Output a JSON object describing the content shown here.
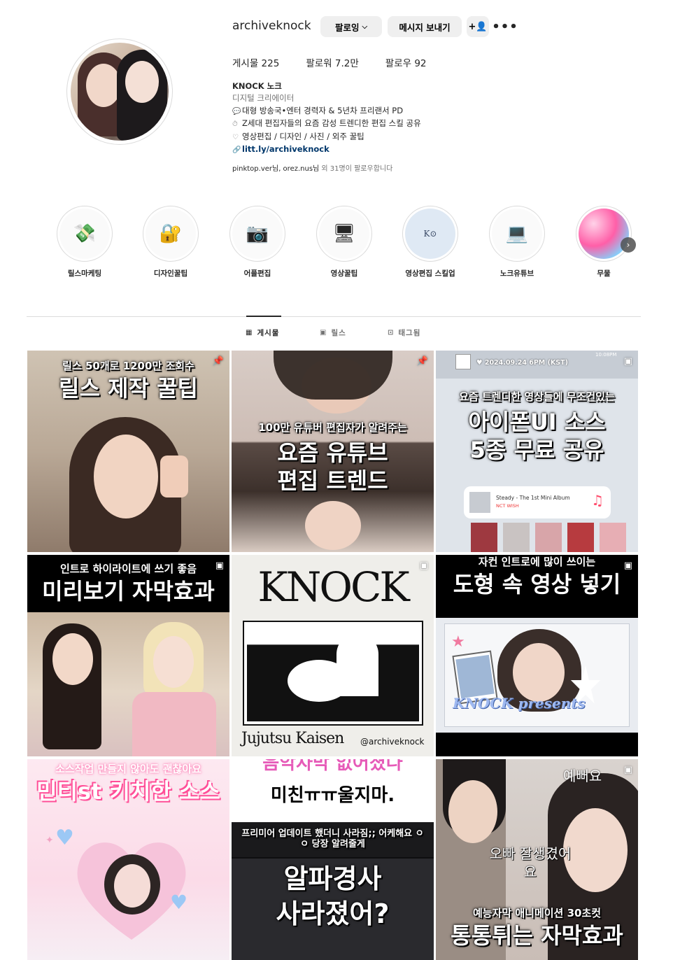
{
  "profile": {
    "username": "archiveknock",
    "follow_button": "팔로잉",
    "message_button": "메시지 보내기",
    "posts_label": "게시물 225",
    "followers_label": "팔로워 7.2만",
    "following_label": "팔로우 92",
    "name": "KNOCK 노크",
    "category": "디지털 크리에이터",
    "bio_lines": [
      "대형 방송국•엔터 경력자 & 5년차 프리랜서 PD",
      "Z세대 편집자들의 요즘 감성 트렌디한 편집 스킬 공유",
      "영상편집 / 디자인 / 사진 / 외주 꿀팁"
    ],
    "link": "litt.ly/archiveknock",
    "followed_by_users": "pinktop.ver님, orez.nus님",
    "followed_by_rest": " 외 31명이 팔로우합니다"
  },
  "highlights": [
    {
      "label": "릴스마케팅",
      "icon": "money-icon"
    },
    {
      "label": "디자인꿀팁",
      "icon": "lock-icon"
    },
    {
      "label": "어플편집",
      "icon": "camera-icon"
    },
    {
      "label": "영상꿀팁",
      "icon": "monitor-icon"
    },
    {
      "label": "영상편집 스킬업",
      "icon": "knock-logo-icon"
    },
    {
      "label": "노크유튜브",
      "icon": "laptop-icon"
    },
    {
      "label": "무물",
      "icon": "gradient-icon"
    }
  ],
  "tabs": [
    {
      "label": "게시물",
      "icon": "grid-icon"
    },
    {
      "label": "릴스",
      "icon": "reels-icon"
    },
    {
      "label": "태그됨",
      "icon": "tag-icon"
    }
  ],
  "posts": [
    {
      "line1": "릴스 50개로 1200만 조회수",
      "line2": "릴스 제작 꿀팁"
    },
    {
      "line1": "100만 유튜버 편집자가 알려주는",
      "line2": "요즘 유튜브",
      "line3": "편집 트렌드"
    },
    {
      "line1": "요즘 트렌디한 영상들에 무조건있는",
      "line2": "아이폰UI 소스",
      "line3": "5종 무료 공유",
      "date": "2024.09.24 6PM (KST)",
      "time": "10:08PM",
      "song": "Steady - The 1st Mini Album",
      "artist": "NCT WISH"
    },
    {
      "line1": "인트로 하이라이트에 쓰기 좋음",
      "line2": "미리보기 자막효과"
    },
    {
      "title": "KNOCK",
      "line1": "Jujutsu Kaisen",
      "line2": "@archiveknock"
    },
    {
      "line1": "자컨 인트로에 많이 쓰이는",
      "line2": "도형 속 영상 넣기",
      "line3": "KNOCK presents"
    },
    {
      "line1": "소스작업 만들지 않아도 괜찮아요",
      "line2": "민티st 키치한 소스"
    },
    {
      "line1": "음악자막 없어졌다",
      "line2": "미친ㅠㅠ울지마.",
      "line3": "프리미어 업데이트 했더니 사라짐;; 어케해요 ㅇㅇ 당장 알려줄게",
      "line4": "알파경사",
      "line5": "사라졌어?"
    },
    {
      "line1": "예뻐요",
      "line2": "오빠 잘생겼어요",
      "line3": "예능자막 애니메이션 30초컷",
      "line4": "통통튀는 자막효과"
    }
  ]
}
